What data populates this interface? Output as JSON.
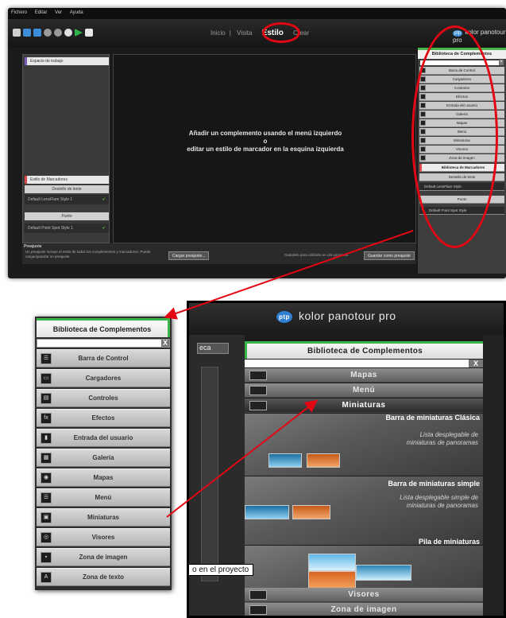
{
  "top_screenshot": {
    "menu": [
      "Fichero",
      "Editar",
      "Ver",
      "Ayuda"
    ],
    "modes": [
      "Inicio",
      "Visita",
      "Estilo",
      "Crear"
    ],
    "active_mode": "Estilo",
    "brand": "kolor panotour pro",
    "brand_badge": "ptp",
    "left_panel": {
      "workspace_header": "Espacio de trabajo",
      "hotspot_style_header": "Estilo de Marcadores",
      "lensflare_label": "Destello de lente",
      "lensflare_item": "Default LensFlare Style 1",
      "point_label": "Punto",
      "point_item": "Default Point Spot Style 1"
    },
    "viewport_message": {
      "line1": "Añadir un complemento usando el menú izquierdo",
      "line2": "o",
      "line3": "editar un estilo de marcador en la esquina izquierda"
    },
    "preset": {
      "title": "Preajuste",
      "description": "Un preajuste incluye el estilo de todos los complementos y marcadores. Puede cargar/guardar un preajuste.",
      "load_button": "Cargar preajuste...",
      "note": "Guárdelo para utilizarlo en otro proyecto",
      "save_button": "Guardar como preajuste"
    },
    "right_panel": {
      "header": "Biblioteca de Complementos",
      "items": [
        "Barra de Control",
        "Cargadores",
        "Controles",
        "Efectos",
        "Entrada del usuario",
        "Galería",
        "Mapas",
        "Menú",
        "Miniaturas",
        "Visores",
        "Zona de imagen"
      ],
      "hotspot_header": "Biblioteca de Marcadores",
      "lensflare": "Destello de lente",
      "lensflare_item": "Default LensFlare Style",
      "point": "Punto",
      "point_item": "Default Point Spot Style"
    }
  },
  "zoom_left": {
    "header": "Biblioteca de Complementos",
    "search_close": "X",
    "items": [
      {
        "label": "Barra de Control",
        "icon": "control-bar-icon",
        "glyph": "☰"
      },
      {
        "label": "Cargadores",
        "icon": "loader-icon",
        "glyph": "▭"
      },
      {
        "label": "Controles",
        "icon": "controls-icon",
        "glyph": "▤"
      },
      {
        "label": "Efectos",
        "icon": "effects-icon",
        "glyph": "fx"
      },
      {
        "label": "Entrada del usuario",
        "icon": "user-input-icon",
        "glyph": "▮"
      },
      {
        "label": "Galería",
        "icon": "gallery-icon",
        "glyph": "▦"
      },
      {
        "label": "Mapas",
        "icon": "map-icon",
        "glyph": "◉"
      },
      {
        "label": "Menú",
        "icon": "menu-icon",
        "glyph": "☰"
      },
      {
        "label": "Miniaturas",
        "icon": "thumbnails-icon",
        "glyph": "▣"
      },
      {
        "label": "Visores",
        "icon": "viewer-icon",
        "glyph": "◎"
      },
      {
        "label": "Zona de imagen",
        "icon": "image-zone-icon",
        "glyph": "▪"
      },
      {
        "label": "Zona de texto",
        "icon": "text-zone-icon",
        "glyph": "A"
      }
    ]
  },
  "zoom_right": {
    "brand": "kolor panotour pro",
    "brand_badge": "ptp",
    "left_tab": "eca",
    "header": "Biblioteca de Complementos",
    "search_close": "X",
    "items_above": [
      "Mapas",
      "Menú",
      "Miniaturas"
    ],
    "thumbnails": [
      {
        "title": "Barra de miniaturas Clásica",
        "desc1": "Lista desplegable de",
        "desc2": "miniaturas de panoramas"
      },
      {
        "title": "Barra de miniaturas simple",
        "desc1": "Lista desplegable simple de",
        "desc2": "miniaturas de panoramas"
      },
      {
        "title": "Pila de miniaturas",
        "desc1": "",
        "desc2": ""
      }
    ],
    "tooltip": "o en el proyecto",
    "items_below": [
      "Visores",
      "Zona de imagen"
    ]
  },
  "colors": {
    "highlight_red": "#e30613",
    "accent_green": "#39b54a",
    "arrow_red": "#e30613"
  }
}
